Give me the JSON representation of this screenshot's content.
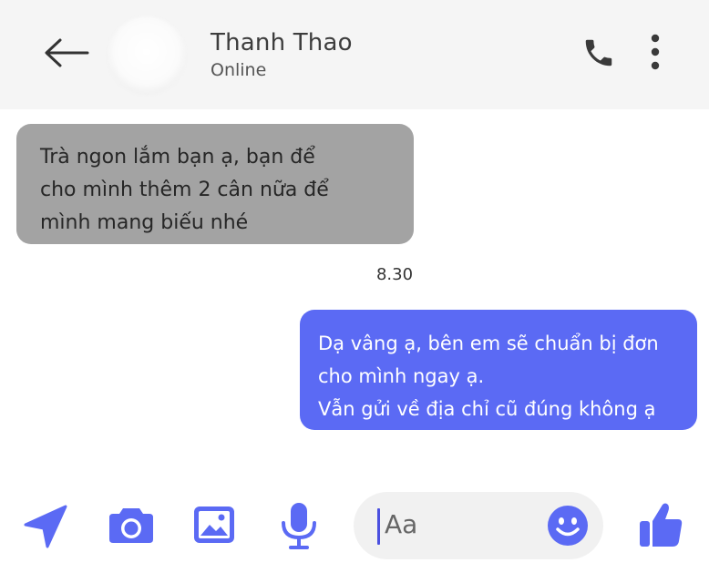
{
  "header": {
    "contact_name": "Thanh Thao",
    "status": "Online"
  },
  "messages": {
    "incoming": {
      "lines": [
        "Trà ngon lắm bạn ạ, bạn để",
        "cho mình thêm 2 cân nữa để",
        "mình mang biếu nhé"
      ]
    },
    "timestamp": "8.30",
    "outgoing": {
      "lines": [
        "Dạ vâng ạ, bên em sẽ chuẩn bị đơn",
        "cho mình ngay ạ.",
        "Vẫn gửi về địa chỉ cũ đúng không ạ"
      ]
    }
  },
  "composer": {
    "placeholder": "Aa"
  },
  "icons": {
    "back": "arrow-left-icon",
    "phone": "phone-icon",
    "more": "more-vertical-icon",
    "send": "send-arrow-icon",
    "camera": "camera-icon",
    "image": "image-icon",
    "mic": "microphone-icon",
    "emoji": "emoji-icon",
    "like": "thumbs-up-icon"
  },
  "colors": {
    "accent": "#5b6af4",
    "incoming_bubble": "#a3a3a3",
    "header_bg": "#f5f5f5"
  }
}
